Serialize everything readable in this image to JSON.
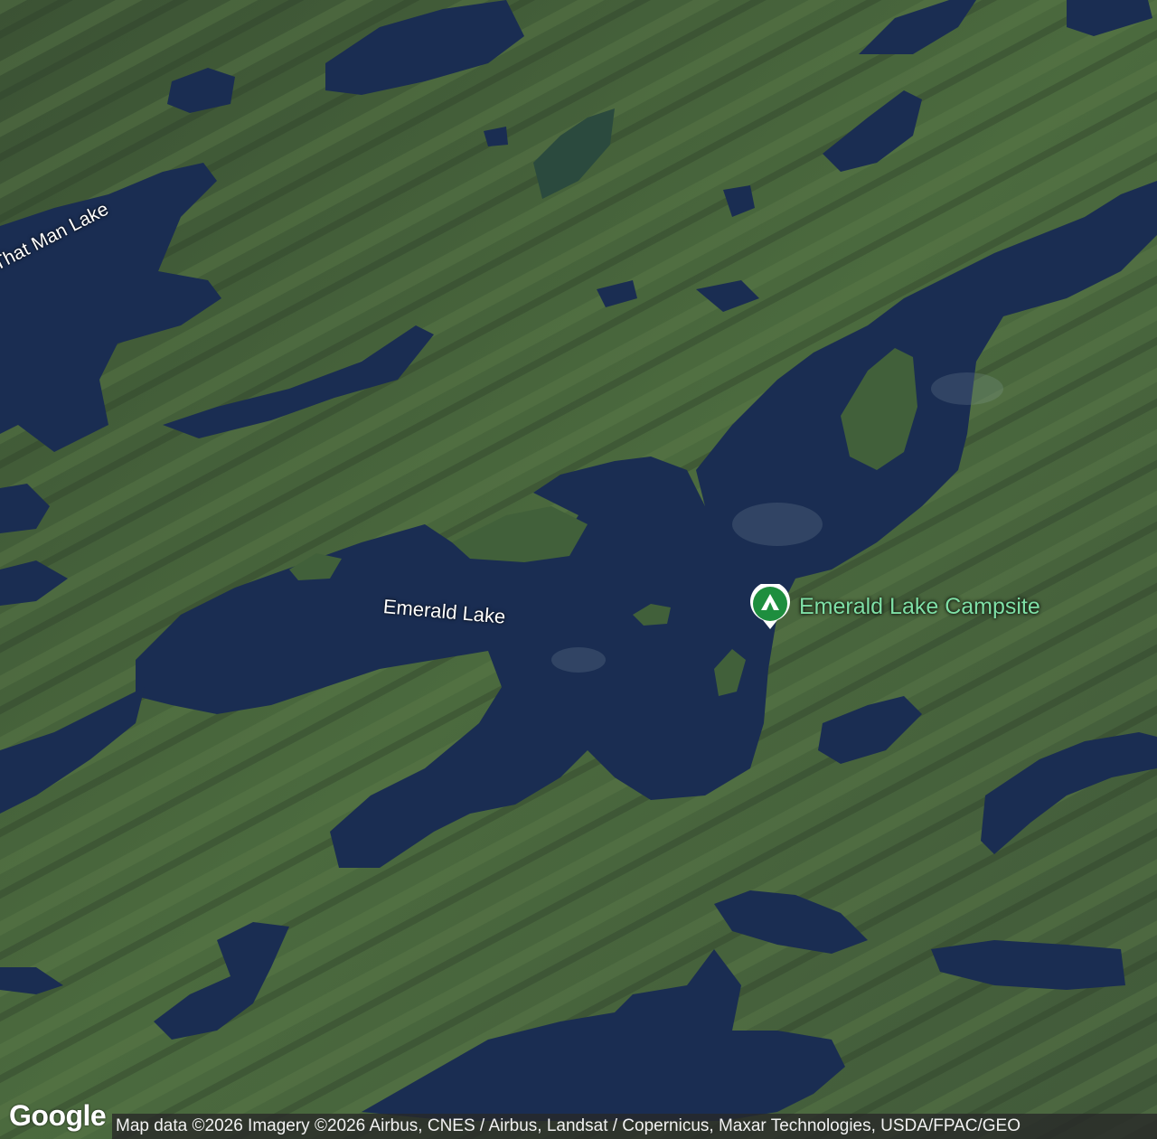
{
  "map": {
    "type": "satellite",
    "labels": {
      "that_man_lake": "That Man Lake",
      "emerald_lake": "Emerald Lake"
    },
    "marker": {
      "icon": "campsite-icon",
      "label": "Emerald Lake Campsite",
      "color": "#1e8e3e"
    },
    "logo": "Google",
    "attribution": "Map data ©2026 Imagery ©2026 Airbus, CNES / Airbus, Landsat / Copernicus, Maxar Technologies, USDA/FPAC/GEO"
  }
}
